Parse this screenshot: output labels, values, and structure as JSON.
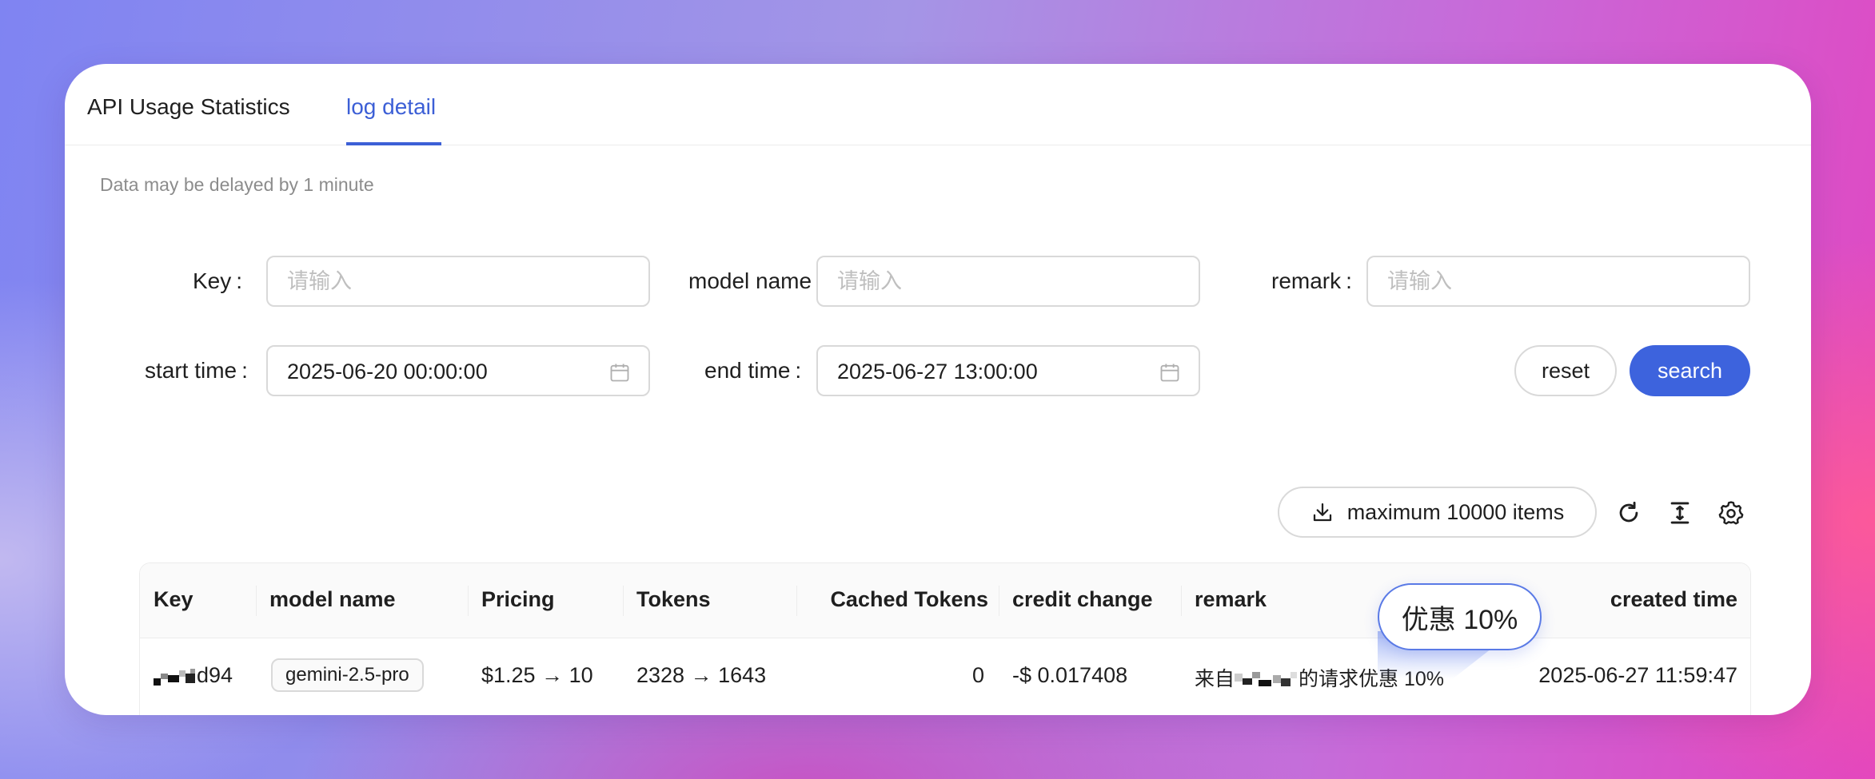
{
  "tabs": [
    {
      "label": "API Usage Statistics",
      "active": false
    },
    {
      "label": "log detail",
      "active": true
    }
  ],
  "notice": "Data may be delayed by 1 minute",
  "filters": {
    "key": {
      "label": "Key",
      "placeholder": "请输入"
    },
    "model_name": {
      "label": "model name",
      "placeholder": "请输入"
    },
    "remark": {
      "label": "remark",
      "placeholder": "请输入"
    },
    "start_time": {
      "label": "start time",
      "value": "2025-06-20 00:00:00"
    },
    "end_time": {
      "label": "end time",
      "value": "2025-06-27 13:00:00"
    },
    "label_suffix": ":"
  },
  "buttons": {
    "reset": "reset",
    "search": "search",
    "export": "maximum 10000 items"
  },
  "toolbar_icons": [
    "download-icon",
    "refresh-icon",
    "column-height-icon",
    "settings-gear-icon"
  ],
  "table": {
    "columns": [
      "Key",
      "model name",
      "Pricing",
      "Tokens",
      "Cached Tokens",
      "credit change",
      "remark",
      "created time"
    ],
    "rows": [
      {
        "key_suffix": "d94",
        "model_name": "gemini-2.5-pro",
        "pricing": "$1.25 → 10",
        "tokens": "2328 → 1643",
        "cached_tokens": "0",
        "credit_change": "-$ 0.017408",
        "remark_prefix": "来自",
        "remark_suffix": "的请求优惠 10%",
        "created_time": "2025-06-27 11:59:47"
      }
    ]
  },
  "tooltip": {
    "text": "优惠 10%"
  },
  "colors": {
    "accent": "#3d63dd",
    "active_tab": "#3c5fd6",
    "border": "#d9d9d9"
  }
}
